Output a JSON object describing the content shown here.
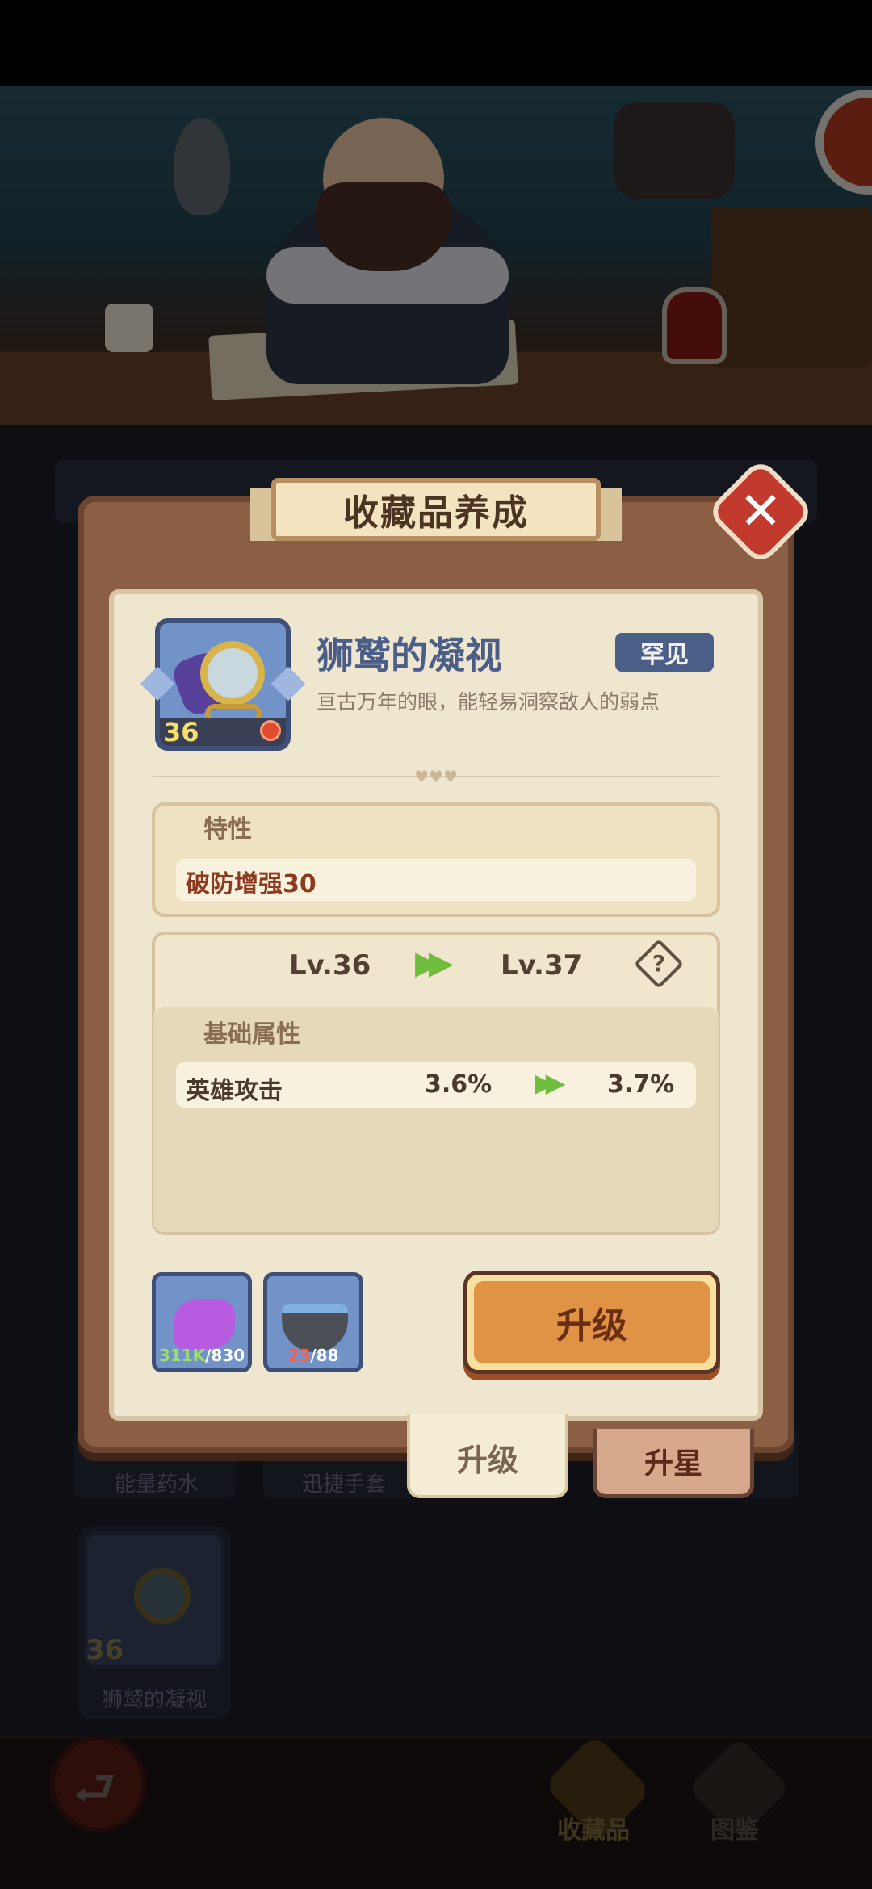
{
  "background": {
    "list_labels": [
      "能量药水",
      "迅捷手套"
    ],
    "selected_card": {
      "level": "36",
      "name": "狮鹫的凝视"
    },
    "nav": {
      "collect_label": "收藏品",
      "book_label": "图鉴"
    }
  },
  "modal": {
    "title": "收藏品养成",
    "close_icon": "close-icon",
    "item": {
      "name": "狮鹫的凝视",
      "rarity": "罕见",
      "description": "亘古万年的眼，能轻易洞察敌人的弱点",
      "level": "36"
    },
    "trait": {
      "header": "特性",
      "value": "破防增强30"
    },
    "level_change": {
      "from": "Lv.36",
      "to": "Lv.37",
      "help_icon": "question-icon"
    },
    "base_stats": {
      "header": "基础属性",
      "rows": [
        {
          "name": "英雄攻击",
          "from": "3.6%",
          "to": "3.7%"
        }
      ]
    },
    "materials": [
      {
        "icon": "crystal-icon",
        "have": "311K",
        "need": "/830"
      },
      {
        "icon": "mortar-icon",
        "have": "23",
        "need": "/88"
      }
    ],
    "upgrade_button": "升级",
    "tabs": [
      {
        "label": "升级",
        "active": true
      },
      {
        "label": "升星",
        "active": false
      }
    ]
  },
  "colors": {
    "accent_green": "#6fbd3d",
    "rarity_blue": "#4a5e87",
    "close_red": "#c2392d",
    "button_orange": "#e09245"
  }
}
